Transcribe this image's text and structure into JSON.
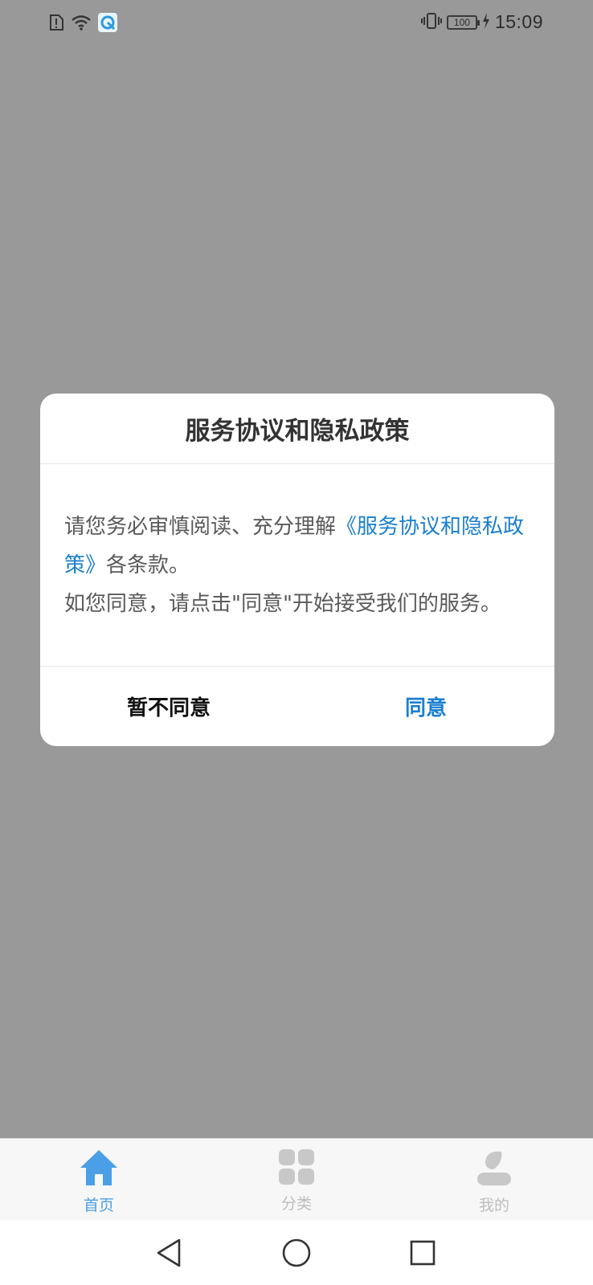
{
  "status_bar": {
    "time": "15:09",
    "battery_level": "100",
    "icons": [
      "sim-alert-icon",
      "wifi-icon",
      "app-notification-icon",
      "vibrate-icon",
      "battery-icon",
      "charging-icon"
    ]
  },
  "dialog": {
    "title": "服务协议和隐私政策",
    "body_intro": "请您务必审慎阅读、充分理解",
    "body_link": "《服务协议和隐私政策》",
    "body_after_link": "各条款。",
    "body_line2": "如您同意，请点击\"同意\"开始接受我们的服务。",
    "decline_label": "暂不同意",
    "agree_label": "同意"
  },
  "tabbar": {
    "tabs": [
      {
        "label": "首页",
        "icon": "home-icon",
        "active": true
      },
      {
        "label": "分类",
        "icon": "grid-icon",
        "active": false
      },
      {
        "label": "我的",
        "icon": "user-icon",
        "active": false
      }
    ]
  },
  "navbar": {
    "icons": [
      "back-icon",
      "home-circle-icon",
      "recents-icon"
    ]
  },
  "colors": {
    "overlay": "#999999",
    "accent": "#1a7fd0",
    "tab_active": "#4a9fe6",
    "tab_inactive": "#c8c8c8"
  }
}
